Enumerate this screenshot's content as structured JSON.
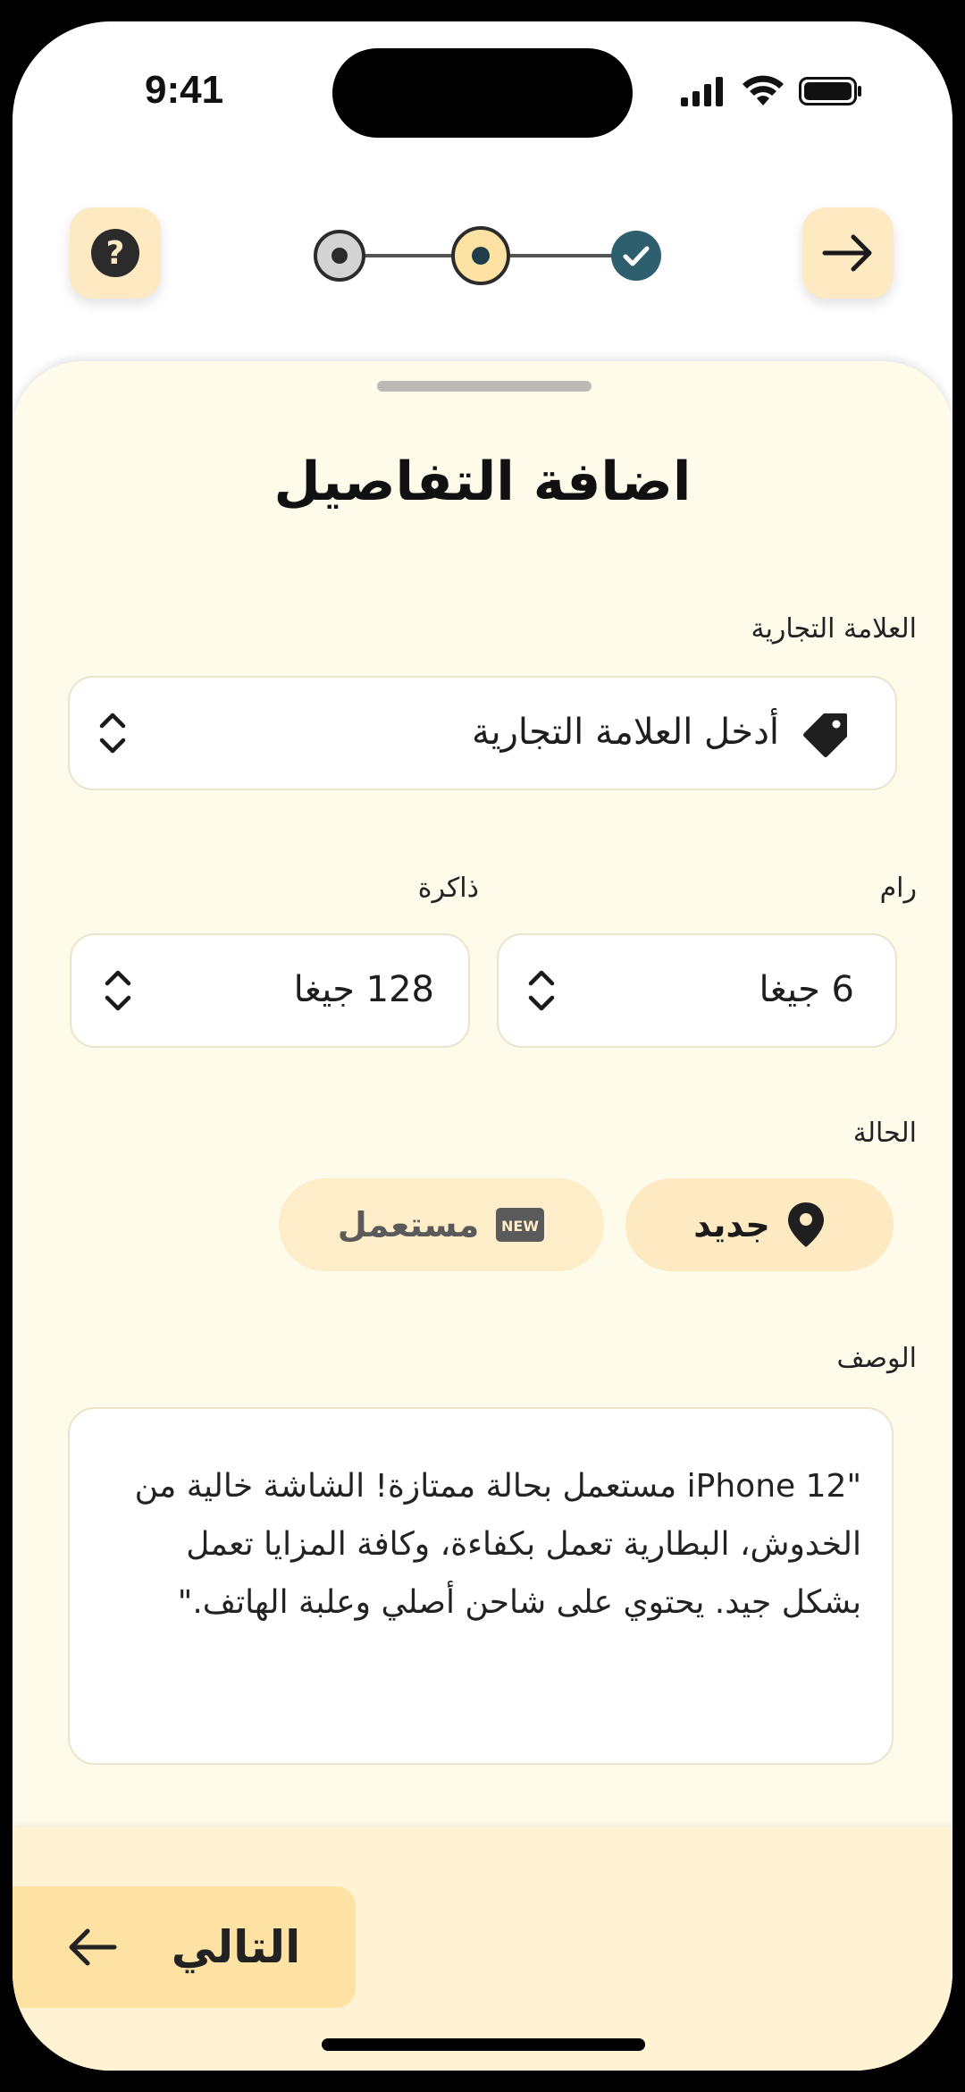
{
  "status": {
    "time": "9:41"
  },
  "title": "اضافة التفاصيل",
  "brand": {
    "label": "العلامة التجارية",
    "placeholder": "أدخل العلامة التجارية"
  },
  "ram": {
    "label": "رام",
    "value": "6 جيغا"
  },
  "storage": {
    "label": "ذاكرة",
    "value": "128 جيغا"
  },
  "condition": {
    "label": "الحالة",
    "options": [
      {
        "label": "جديد",
        "icon": "location-pin-icon",
        "selected": true
      },
      {
        "label": "مستعمل",
        "icon": "new-badge-icon",
        "badge_text": "NEW",
        "selected": false
      }
    ]
  },
  "description": {
    "label": "الوصف",
    "value": "\"iPhone 12 مستعمل بحالة ممتازة! الشاشة خالية من الخدوش، البطارية تعمل بكفاءة، وكافة المزايا تعمل بشكل جيد. يحتوي على شاحن أصلي وعلبة الهاتف.\""
  },
  "next_button": {
    "label": "التالي"
  },
  "stepper": {
    "steps": 3,
    "current": 2
  },
  "colors": {
    "sheet": "#fffbea",
    "accent": "#fde2a4",
    "done": "#2e5f6e",
    "button": "#fde9c2"
  }
}
